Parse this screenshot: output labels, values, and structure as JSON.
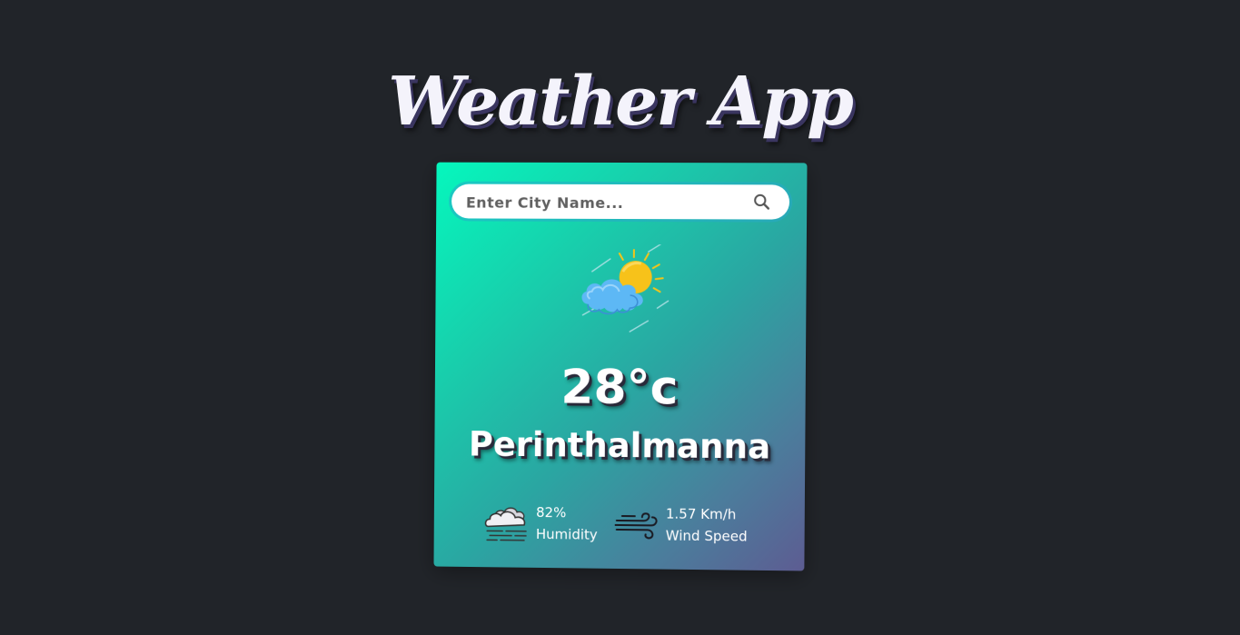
{
  "app": {
    "title": "Weather App"
  },
  "search": {
    "placeholder": "Enter City Name...",
    "value": "",
    "icon": "search-icon"
  },
  "weather": {
    "icon": "partly-cloudy-icon",
    "temperature": "28°c",
    "city": "Perinthalmanna"
  },
  "details": {
    "humidity": {
      "icon": "humidity-icon",
      "value": "82%",
      "label": "Humidity"
    },
    "wind": {
      "icon": "wind-icon",
      "value": "1.57 Km/h",
      "label": "Wind Speed"
    }
  },
  "colors": {
    "background": "#212429",
    "card_gradient_start": "#05f7bd",
    "card_gradient_end": "#5d5c92",
    "text": "#ffffff"
  }
}
